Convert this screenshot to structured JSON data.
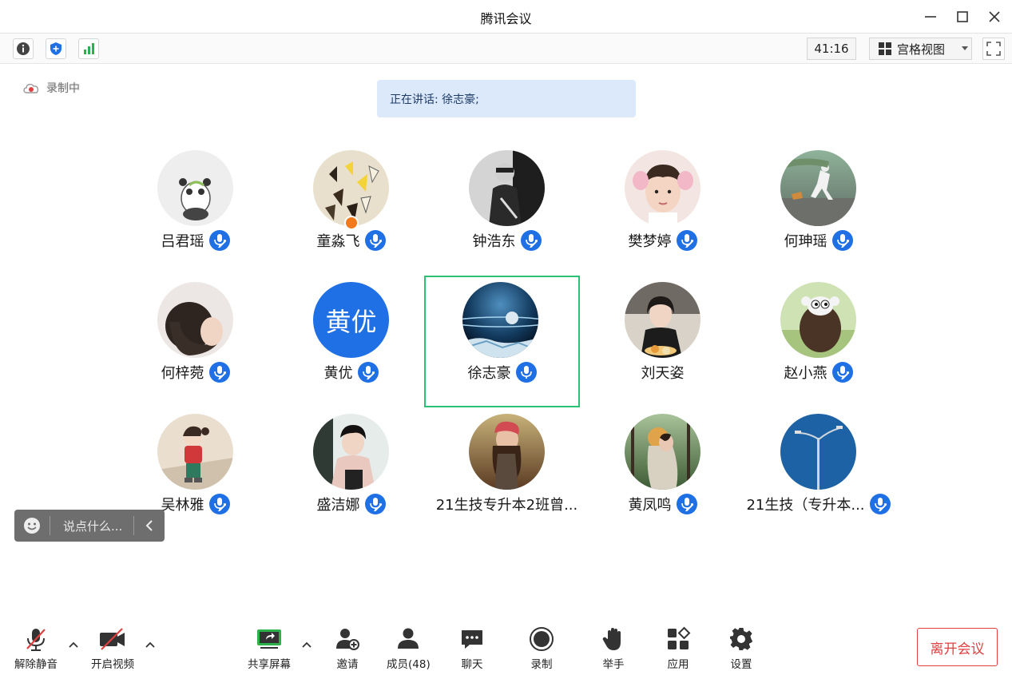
{
  "window": {
    "title": "腾讯会议"
  },
  "toolbar": {
    "timer": "41:16",
    "view_mode": "宫格视图"
  },
  "recording": {
    "label": "录制中"
  },
  "speaking": {
    "text": "正在讲话: 徐志豪;"
  },
  "participants": [
    {
      "name": "吕君瑶",
      "mic": "muted",
      "avatar": "panda-photo"
    },
    {
      "name": "童淼飞",
      "mic": "muted",
      "avatar": "butterflies-photo",
      "host_badge": true
    },
    {
      "name": "钟浩东",
      "mic": "muted",
      "avatar": "person-dark-photo"
    },
    {
      "name": "樊梦婷",
      "mic": "muted",
      "avatar": "portrait-photo"
    },
    {
      "name": "何珅瑶",
      "mic": "muted",
      "avatar": "street-photo"
    },
    {
      "name": "何梓菀",
      "mic": "muted",
      "avatar": "hair-photo"
    },
    {
      "name": "黄优",
      "mic": "muted",
      "avatar": "text-avatar",
      "avatar_text": "黄优"
    },
    {
      "name": "徐志豪",
      "mic": "active",
      "avatar": "space-planet-photo",
      "active_speaker": true
    },
    {
      "name": "刘天姿",
      "mic": "none",
      "avatar": "selfie-photo"
    },
    {
      "name": "赵小燕",
      "mic": "muted",
      "avatar": "sheep-cartoon"
    },
    {
      "name": "吴林雅",
      "mic": "muted",
      "avatar": "cartoon-girl"
    },
    {
      "name": "盛洁娜",
      "mic": "muted",
      "avatar": "girl-photo"
    },
    {
      "name": "21生技专升本2班曾...",
      "mic": "none",
      "avatar": "girl-sunset-photo"
    },
    {
      "name": "黄凤鸣",
      "mic": "muted",
      "avatar": "forest-photo"
    },
    {
      "name": "21生技（专升本...",
      "mic": "muted",
      "avatar": "sky-lamp-photo"
    }
  ],
  "chat": {
    "placeholder": "说点什么..."
  },
  "bottom": {
    "unmute": "解除静音",
    "video": "开启视频",
    "share": "共享屏幕",
    "invite": "邀请",
    "members": "成员(48)",
    "chat": "聊天",
    "record": "录制",
    "raise_hand": "举手",
    "apps": "应用",
    "settings": "设置",
    "leave": "离开会议"
  },
  "colors": {
    "accent": "#1f6fe5",
    "active_border": "#2bc276",
    "leave": "#e24040",
    "speaker_bg": "#dbe9fb"
  }
}
